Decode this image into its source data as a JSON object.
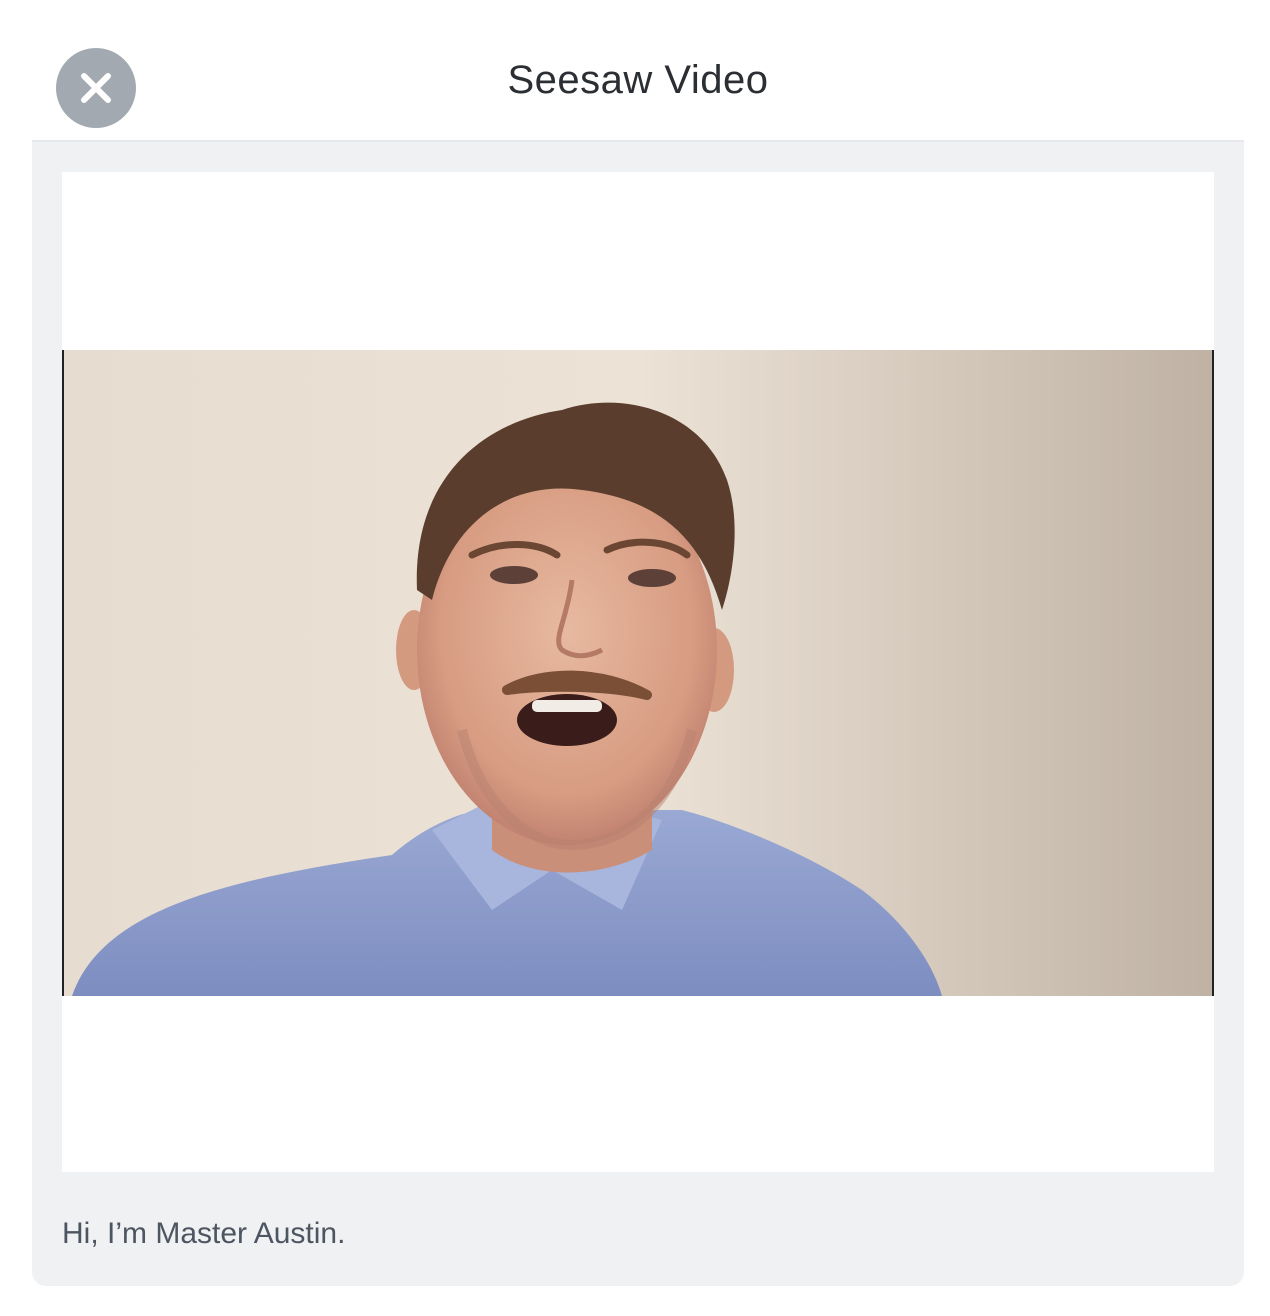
{
  "header": {
    "title": "Seesaw Video",
    "close_icon": "close-icon"
  },
  "video": {
    "content": "video-frame-person-speaking"
  },
  "caption": {
    "text": "Hi, I’m Master Austin."
  },
  "colors": {
    "close_button_bg": "#a3a9b0",
    "panel_bg": "#f0f1f3",
    "title_text": "#2b2f33",
    "caption_text": "#4d5561"
  }
}
